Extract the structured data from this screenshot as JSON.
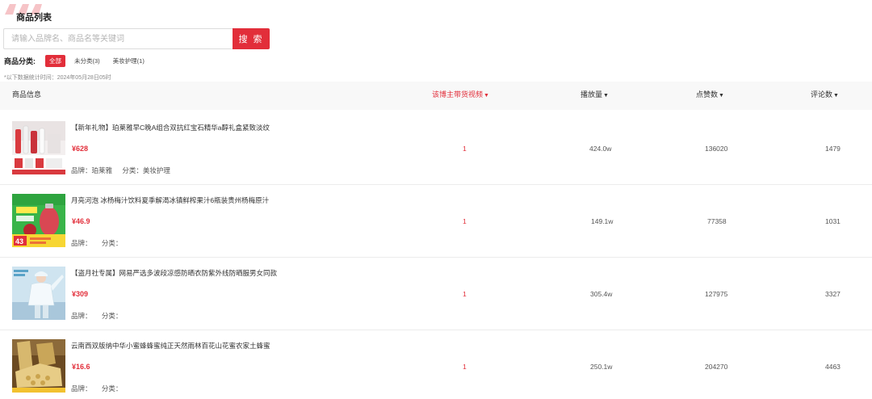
{
  "page": {
    "title": "商品列表"
  },
  "search": {
    "placeholder": "请输入品牌名、商品名等关键词",
    "button_label": "搜 索"
  },
  "categories": {
    "label": "商品分类:",
    "items": [
      {
        "label": "全部",
        "active": true
      },
      {
        "label": "未分类(3)",
        "active": false
      },
      {
        "label": "美妆护理(1)",
        "active": false
      }
    ]
  },
  "stat_note": "*以下数据统计时间：2024年05月28日05时",
  "table": {
    "headers": {
      "product": "商品信息",
      "videos": "该博主带货视频",
      "plays": "播放量",
      "likes": "点赞数",
      "comments": "评论数"
    },
    "caret_icon": "caret-down-icon",
    "rows": [
      {
        "title": "【新年礼物】珀莱雅早C晚A组合双抗红宝石精华a醇礼盒紧致淡纹",
        "price": "¥628",
        "brand_label": "品牌：珀莱雅",
        "category_label": "分类：美妆护理",
        "videos": "1",
        "plays": "424.0w",
        "likes": "136020",
        "comments": "1479",
        "thumb_icon": "skincare-giftbox-image"
      },
      {
        "title": "月亮河泡 冰杨梅汁饮料夏季解渴冰镇鲜榨果汁6瓶装贵州杨梅原汁",
        "price": "¥46.9",
        "brand_label": "品牌：",
        "category_label": "分类：",
        "videos": "1",
        "plays": "149.1w",
        "likes": "77358",
        "comments": "1031",
        "thumb_icon": "bayberry-juice-image",
        "thumb_text": "43"
      },
      {
        "title": "【盗月社专属】网易严选多波段凉感防晒衣防紫外线防晒服男女同款",
        "price": "¥309",
        "brand_label": "品牌：",
        "category_label": "分类：",
        "videos": "1",
        "plays": "305.4w",
        "likes": "127975",
        "comments": "3327",
        "thumb_icon": "sun-protection-jacket-image"
      },
      {
        "title": "云南西双版纳中华小蜜蜂蜂蜜纯正天然雨林百花山花蜜农家土蜂蜜",
        "price": "¥16.6",
        "brand_label": "品牌：",
        "category_label": "分类：",
        "videos": "1",
        "plays": "250.1w",
        "likes": "204270",
        "comments": "4463",
        "thumb_icon": "honeycomb-image"
      }
    ]
  },
  "colors": {
    "accent": "#e22e3a",
    "header_bg": "#f8f8f8",
    "border": "#ececec"
  }
}
